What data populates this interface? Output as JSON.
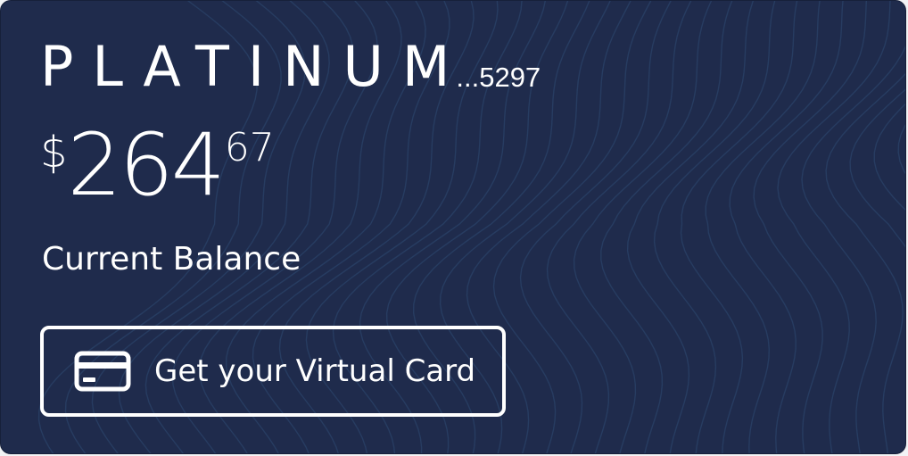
{
  "card": {
    "product_name": "PLATINUM",
    "account_suffix": "...5297",
    "balance": {
      "currency_symbol": "$",
      "dollars": "264",
      "cents": "67",
      "label": "Current Balance"
    },
    "action": {
      "label": "Get your Virtual Card",
      "icon": "credit-card-icon"
    }
  },
  "colors": {
    "card_background": "#1f2b4c",
    "pattern_lines": "#2d4a72",
    "text": "#ffffff"
  }
}
